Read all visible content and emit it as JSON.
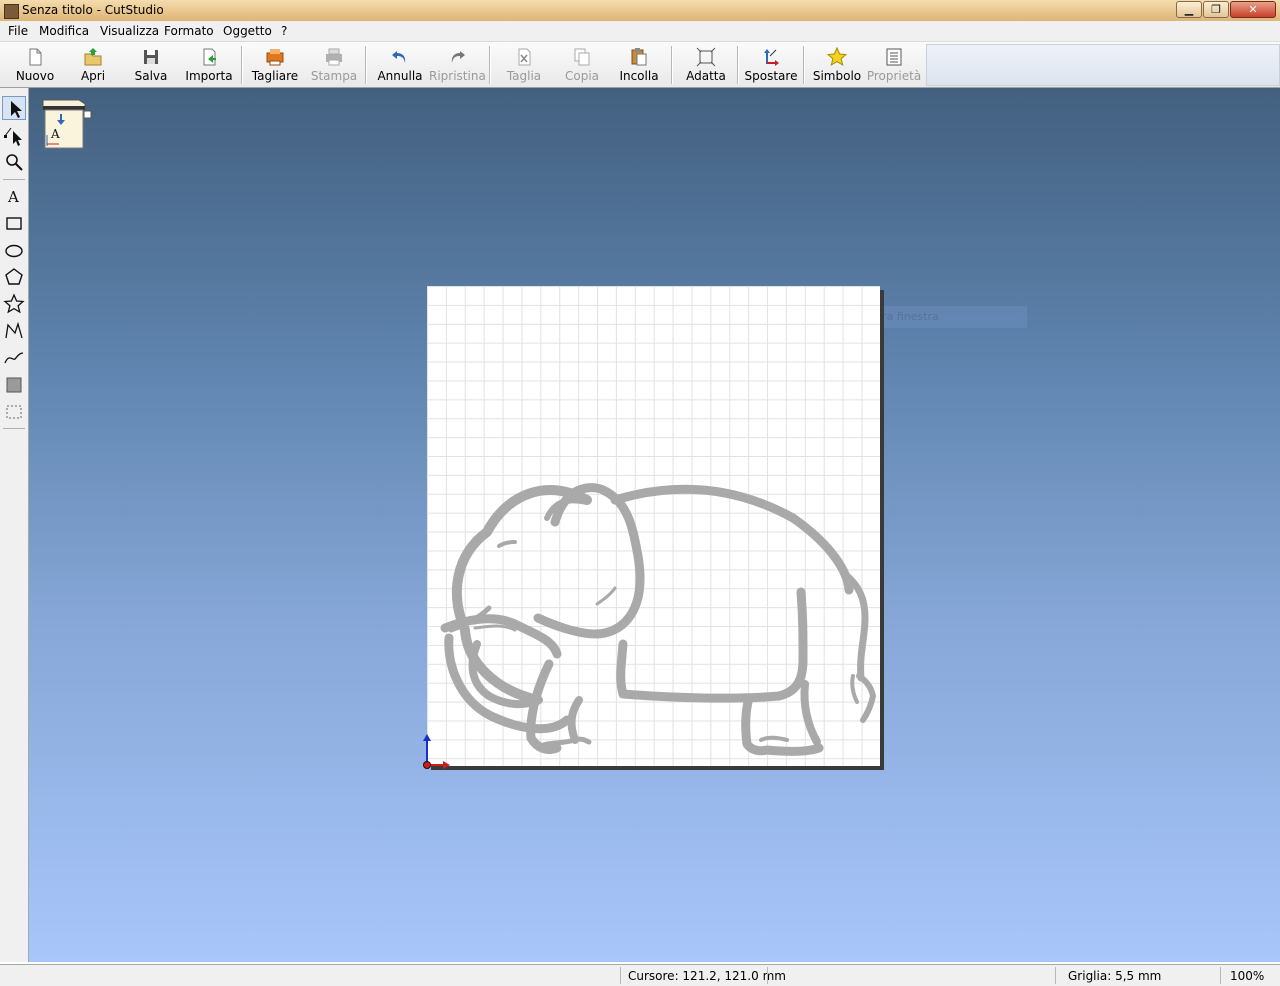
{
  "window": {
    "title": "Senza titolo - CutStudio"
  },
  "menu": [
    "File",
    "Modifica",
    "Visualizza",
    "Formato",
    "Oggetto",
    "?"
  ],
  "toolbar": {
    "nuovo": "Nuovo",
    "apri": "Apri",
    "salva": "Salva",
    "importa": "Importa",
    "tagliare": "Tagliare",
    "stampa": "Stampa",
    "annulla": "Annulla",
    "ripristina": "Ripristina",
    "taglia": "Taglia",
    "copia": "Copia",
    "incolla": "Incolla",
    "adatta": "Adatta",
    "spostare": "Spostare",
    "simbolo": "Simbolo",
    "proprieta": "Proprietà"
  },
  "canvas": {
    "ghost_label": "Cattura finestra"
  },
  "status": {
    "cursor": "Cursore: 121.2, 121.0 mm",
    "grid": "Griglia: 5,5 mm",
    "zoom": "100%"
  },
  "colors": {
    "accent_green": "#2e9e3a",
    "accent_orange": "#e07820",
    "accent_blue": "#2e68b8",
    "shape_gray": "#a9a9a9"
  }
}
